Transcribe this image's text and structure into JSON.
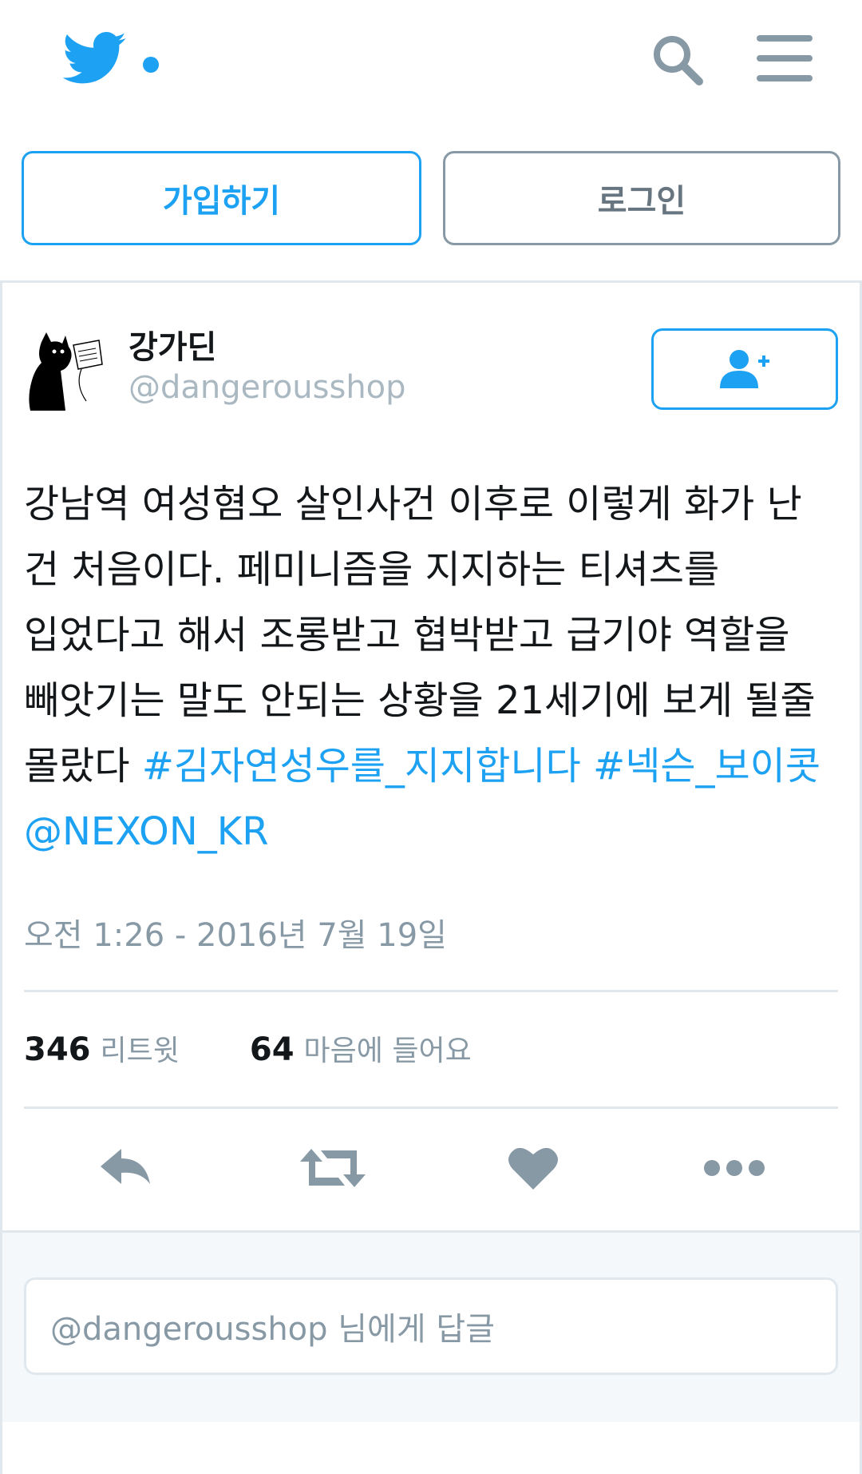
{
  "header": {
    "logo_icon": "twitter-bird-icon",
    "search_icon": "search-icon",
    "menu_icon": "hamburger-menu-icon",
    "brand_color": "#1da1f2"
  },
  "auth": {
    "signup_label": "가입하기",
    "login_label": "로그인"
  },
  "tweet": {
    "display_name": "강가딘",
    "handle": "@dangerousshop",
    "follow_icon": "follow-user-icon",
    "text_plain": "강남역 여성혐오 살인사건 이후로 이렇게 화가 난 건 처음이다. 페미니즘을 지지하는 티셔츠를 입었다고 해서 조롱받고 협박받고 급기야 역할을 빼앗기는 말도 안되는 상황을 21세기에 보게 될줄 몰랐다 ",
    "hashtag_1": "#김자연성우를_지지합니다",
    "hashtag_2": "#넥슨_보이콧",
    "mention": "@NEXON_KR",
    "timestamp": "오전 1:26 - 2016년 7월 19일",
    "retweet_count": "346",
    "retweet_label": "리트윗",
    "like_count": "64",
    "like_label": "마음에 들어요"
  },
  "actions": {
    "reply_icon": "reply-icon",
    "retweet_icon": "retweet-icon",
    "like_icon": "heart-icon",
    "more_icon": "more-icon"
  },
  "reply": {
    "placeholder": "@dangerousshop 님에게 답글"
  }
}
